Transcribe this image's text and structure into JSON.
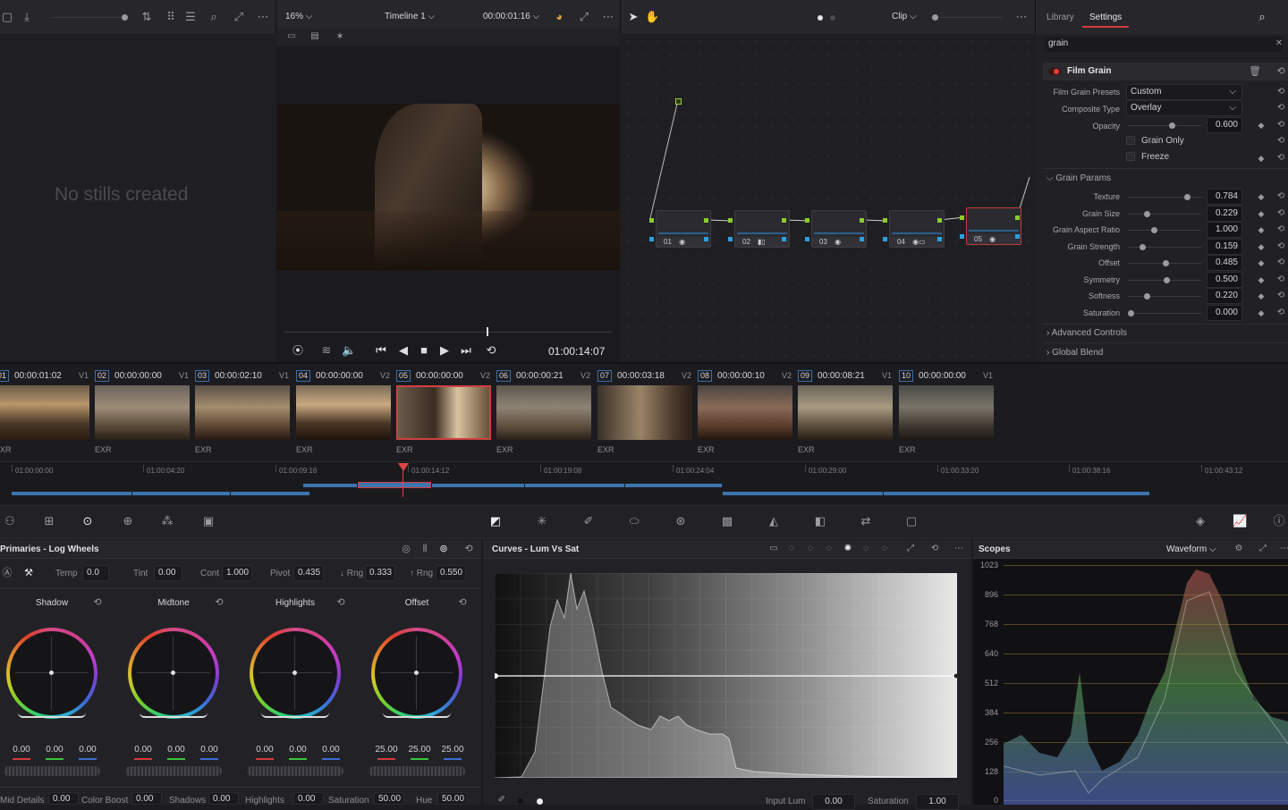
{
  "top": {
    "zoom": "16%",
    "timeline": "Timeline 1",
    "timecode": "00:00:01:16",
    "clip_mode": "Clip",
    "tab_library": "Library",
    "tab_settings": "Settings"
  },
  "gallery": {
    "empty": "No stills created"
  },
  "viewer": {
    "timecode": "01:00:14:07"
  },
  "nodes": [
    {
      "label": "01"
    },
    {
      "label": "02"
    },
    {
      "label": "03"
    },
    {
      "label": "04"
    },
    {
      "label": "05"
    }
  ],
  "fx": {
    "search": "grain",
    "title": "Film Grain",
    "presets_label": "Film Grain Presets",
    "presets_value": "Custom",
    "composite_label": "Composite Type",
    "composite_value": "Overlay",
    "opacity_label": "Opacity",
    "opacity_value": "0.600",
    "grain_only": "Grain Only",
    "freeze": "Freeze",
    "grain_params": "Grain Params",
    "params": [
      {
        "label": "Texture",
        "value": "0.784",
        "pos": 0.784
      },
      {
        "label": "Grain Size",
        "value": "0.229",
        "pos": 0.229
      },
      {
        "label": "Grain Aspect Ratio",
        "value": "1.000",
        "pos": 0.33
      },
      {
        "label": "Grain Strength",
        "value": "0.159",
        "pos": 0.159
      },
      {
        "label": "Offset",
        "value": "0.485",
        "pos": 0.485
      },
      {
        "label": "Symmetry",
        "value": "0.500",
        "pos": 0.5
      },
      {
        "label": "Softness",
        "value": "0.220",
        "pos": 0.22
      },
      {
        "label": "Saturation",
        "value": "0.000",
        "pos": 0.0
      }
    ],
    "advanced": "Advanced Controls",
    "global": "Global Blend"
  },
  "clips": [
    {
      "num": "01",
      "tc": "00:00:01:02",
      "track": "V1",
      "fmt": "EXR"
    },
    {
      "num": "02",
      "tc": "00:00:00:00",
      "track": "V1",
      "fmt": "EXR"
    },
    {
      "num": "03",
      "tc": "00:00:02:10",
      "track": "V1",
      "fmt": "EXR"
    },
    {
      "num": "04",
      "tc": "00:00:00:00",
      "track": "V2",
      "fmt": "EXR"
    },
    {
      "num": "05",
      "tc": "00:00:00:00",
      "track": "V2",
      "fmt": "EXR"
    },
    {
      "num": "06",
      "tc": "00:00:00:21",
      "track": "V2",
      "fmt": "EXR"
    },
    {
      "num": "07",
      "tc": "00:00:03:18",
      "track": "V2",
      "fmt": "EXR"
    },
    {
      "num": "08",
      "tc": "00:00:00:10",
      "track": "V2",
      "fmt": "EXR"
    },
    {
      "num": "09",
      "tc": "00:00:08:21",
      "track": "V1",
      "fmt": "EXR"
    },
    {
      "num": "10",
      "tc": "00:00:00:00",
      "track": "V1",
      "fmt": "EXR"
    }
  ],
  "ruler": [
    "01:00:00:00",
    "01:00:04:20",
    "01:00:09:16",
    "01:00:14:12",
    "01:00:19:08",
    "01:00:24:04",
    "01:00:29:00",
    "01:00:33:20",
    "01:00:38:16",
    "01:00:43:12"
  ],
  "primaries": {
    "title": "Primaries - Log Wheels",
    "temp_label": "Temp",
    "temp": "0.0",
    "tint_label": "Tint",
    "tint": "0.00",
    "cont_label": "Cont",
    "cont": "1.000",
    "pivot_label": "Pivot",
    "pivot": "0.435",
    "lrng_label": "↓ Rng",
    "lrng": "0.333",
    "hrng_label": "↑ Rng",
    "hrng": "0.550",
    "wheels": [
      {
        "name": "Shadow",
        "v": [
          "0.00",
          "0.00",
          "0.00"
        ]
      },
      {
        "name": "Midtone",
        "v": [
          "0.00",
          "0.00",
          "0.00"
        ]
      },
      {
        "name": "Highlights",
        "v": [
          "0.00",
          "0.00",
          "0.00"
        ]
      },
      {
        "name": "Offset",
        "v": [
          "25.00",
          "25.00",
          "25.00"
        ]
      }
    ],
    "bottom": [
      {
        "label": "Mid Details",
        "value": "0.00"
      },
      {
        "label": "Color Boost",
        "value": "0.00"
      },
      {
        "label": "Shadows",
        "value": "0.00"
      },
      {
        "label": "Highlights",
        "value": "0.00"
      },
      {
        "label": "Saturation",
        "value": "50.00"
      },
      {
        "label": "Hue",
        "value": "50.00"
      }
    ]
  },
  "curves": {
    "title": "Curves - Lum Vs Sat",
    "input_lum_label": "Input Lum",
    "input_lum": "0.00",
    "saturation_label": "Saturation",
    "saturation": "1.00"
  },
  "scopes": {
    "title": "Scopes",
    "mode": "Waveform",
    "ticks": [
      "1023",
      "896",
      "768",
      "640",
      "512",
      "384",
      "256",
      "128",
      "0"
    ]
  }
}
